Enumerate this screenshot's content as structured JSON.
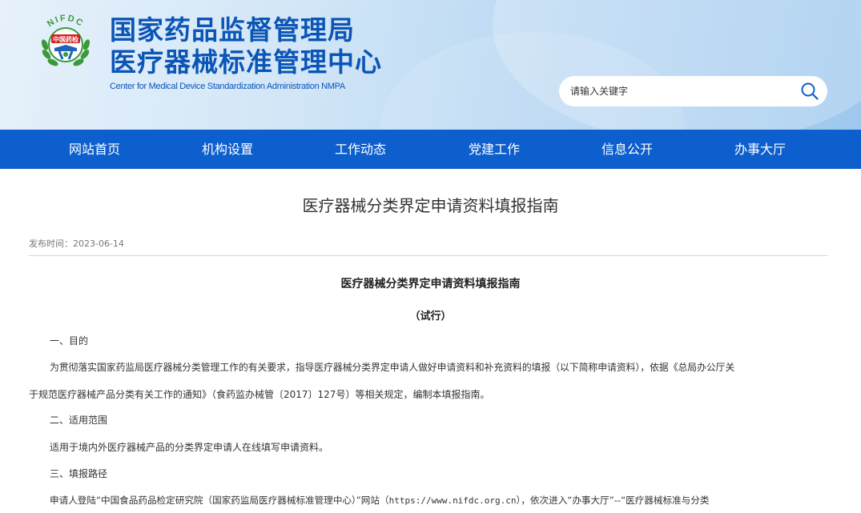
{
  "header": {
    "logo_text_top": "NIFDC",
    "logo_text_badge": "中国药检",
    "title_line1": "国家药品监督管理局",
    "title_line2": "医疗器械标准管理中心",
    "subtitle": "Center for Medical Device Standardization Administration NMPA",
    "brand_color": "#0b55b6"
  },
  "search": {
    "placeholder": "请输入关键字",
    "icon": "search-icon"
  },
  "nav": {
    "items": [
      {
        "label": "网站首页"
      },
      {
        "label": "机构设置"
      },
      {
        "label": "工作动态"
      },
      {
        "label": "党建工作"
      },
      {
        "label": "信息公开"
      },
      {
        "label": "办事大厅"
      }
    ],
    "bg_color": "#0c5fcd"
  },
  "article": {
    "title": "医疗器械分类界定申请资料填报指南",
    "pubdate": "发布时间：2023-06-14",
    "doc_title": "医疗器械分类界定申请资料填报指南",
    "doc_subtitle": "（试行）",
    "sections": {
      "s1_heading": "一、目的",
      "s1_line1": "为贯彻落实国家药监局医疗器械分类管理工作的有关要求，指导医疗器械分类界定申请人做好申请资料和补充资料的填报（以下简称申请资料），依据《总局办公厅关",
      "s1_line2": "于规范医疗器械产品分类有关工作的通知》（食药监办械管〔2017〕127号）等相关规定，编制本填报指南。",
      "s2_heading": "二、适用范围",
      "s2_line1": "适用于境内外医疗器械产品的分类界定申请人在线填写申请资料。",
      "s3_heading": "三、填报路径",
      "s3_line1_a": "申请人登陆“中国食品药品检定研究院（国家药监局医疗器械标准管理中心）”网站（",
      "s3_line1_url": "https://www.nifdc.org.cn",
      "s3_line1_b": "），依次进入“办事大厅”--“医疗器械标准与分类"
    }
  }
}
